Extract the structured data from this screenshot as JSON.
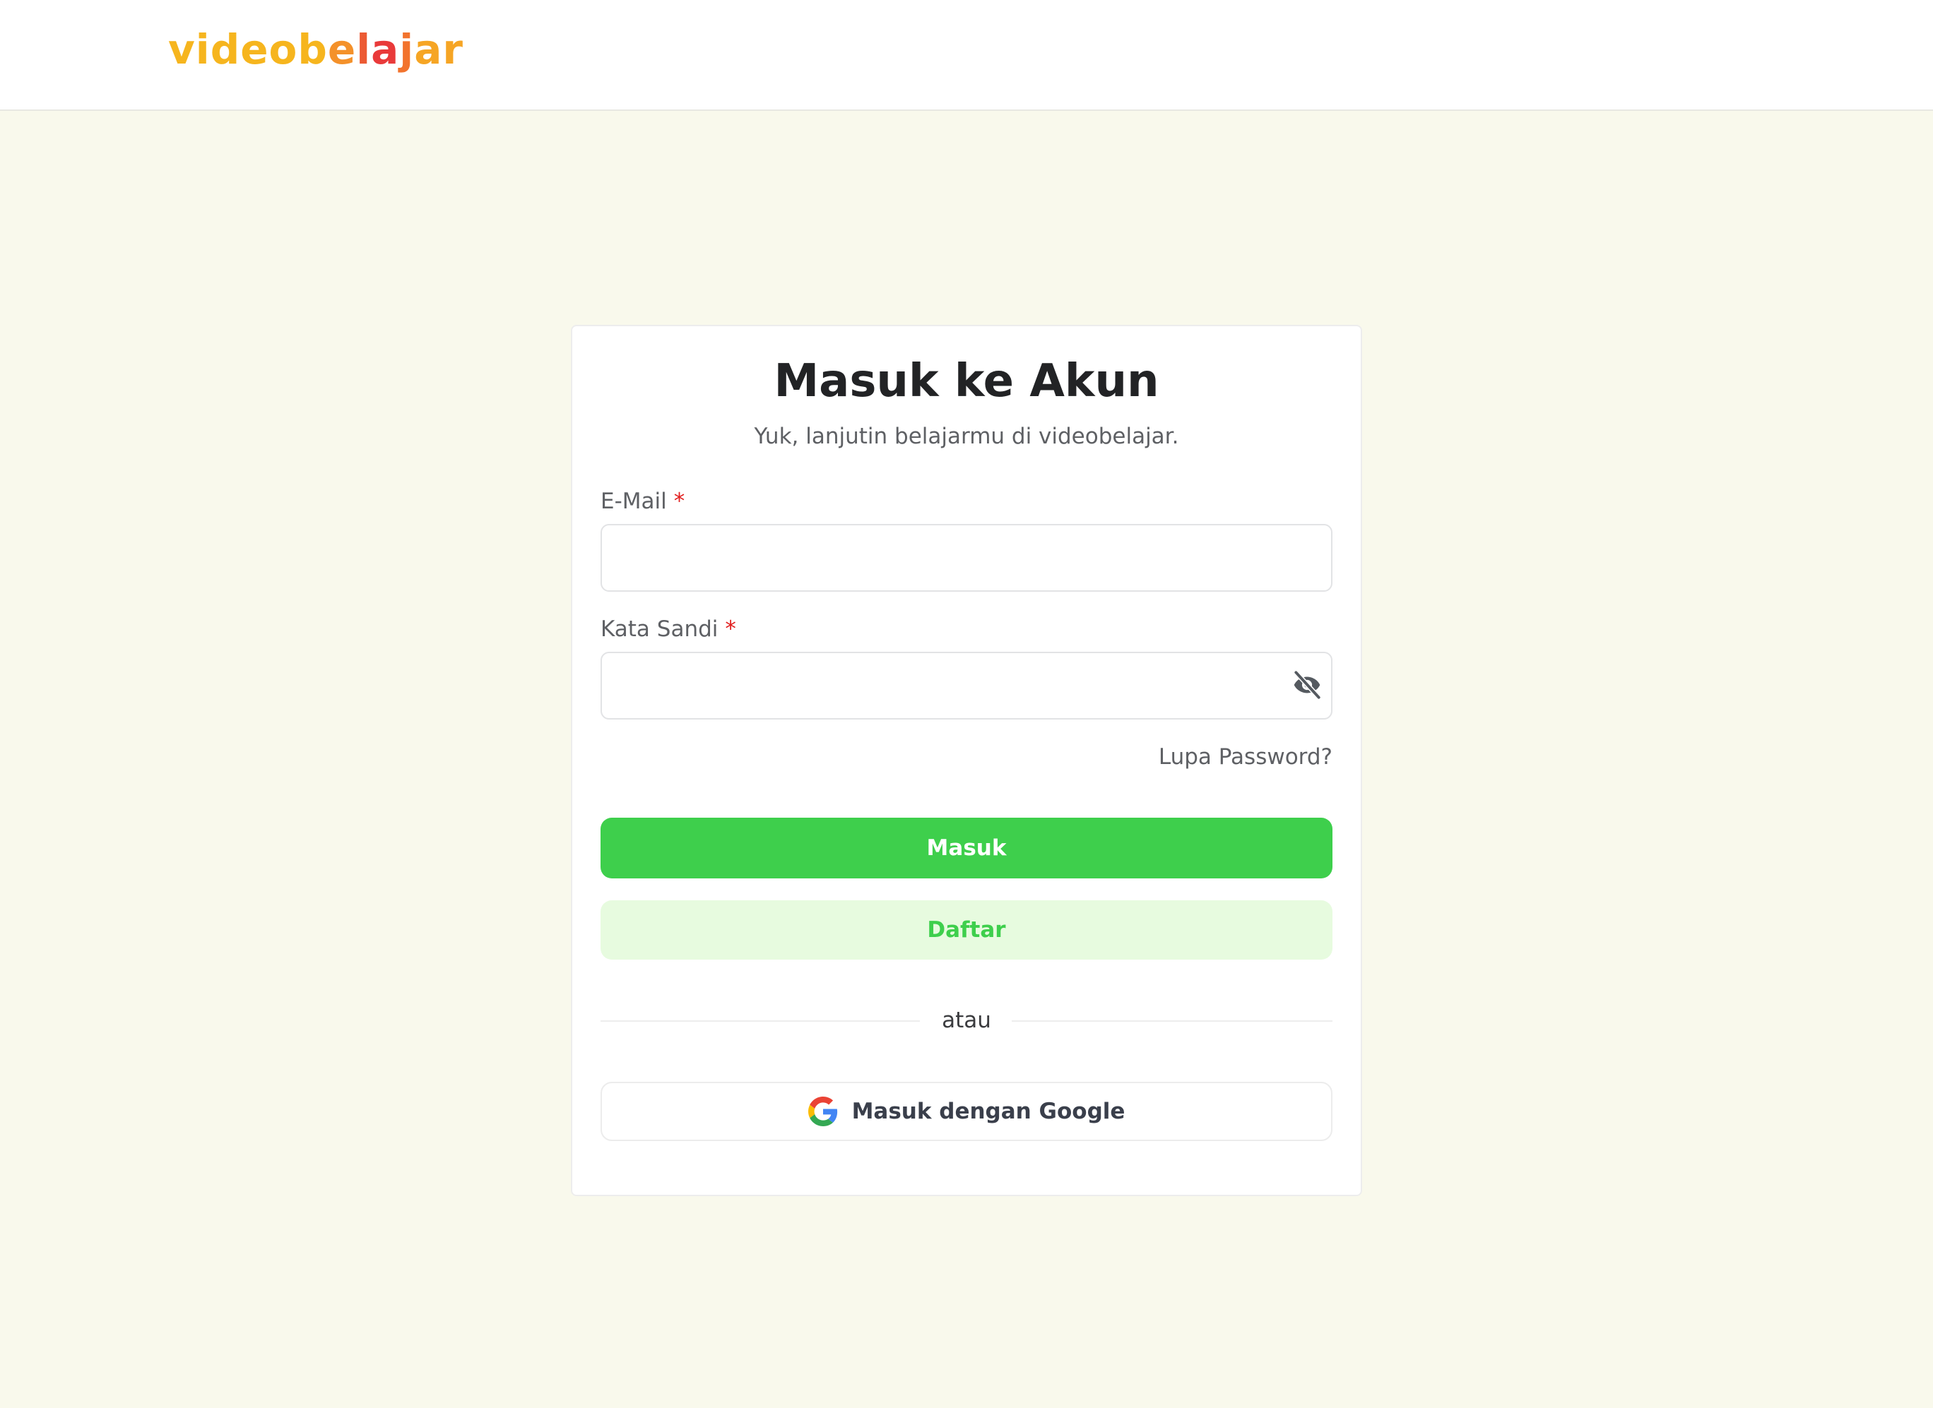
{
  "header": {
    "logo": {
      "text": "videobelajar",
      "parts": [
        {
          "text": "videob",
          "color": "#f6b51e"
        },
        {
          "text": "e",
          "color": "#f4912a"
        },
        {
          "text": "l",
          "color": "#ec5a33"
        },
        {
          "text": "a",
          "color": "#e93a3a"
        },
        {
          "text": "j",
          "color": "#f2732d"
        },
        {
          "text": "ar",
          "color": "#f6a524"
        }
      ]
    }
  },
  "login": {
    "title": "Masuk ke Akun",
    "subtitle": "Yuk, lanjutin belajarmu di videobelajar.",
    "email": {
      "label": "E-Mail",
      "required_mark": "*",
      "value": "",
      "placeholder": ""
    },
    "password": {
      "label": "Kata Sandi",
      "required_mark": "*",
      "value": "",
      "placeholder": "",
      "toggle_icon": "eye-off-icon"
    },
    "forgot_label": "Lupa Password?",
    "submit_label": "Masuk",
    "register_label": "Daftar",
    "divider_label": "atau",
    "google_label": "Masuk dengan Google",
    "google_icon": "google-icon"
  },
  "colors": {
    "page_background": "#f9f9ec",
    "primary": "#3ecf4c",
    "primary_light": "#e7fbdf",
    "required": "#e11d1d",
    "muted_text": "#5e6064"
  }
}
